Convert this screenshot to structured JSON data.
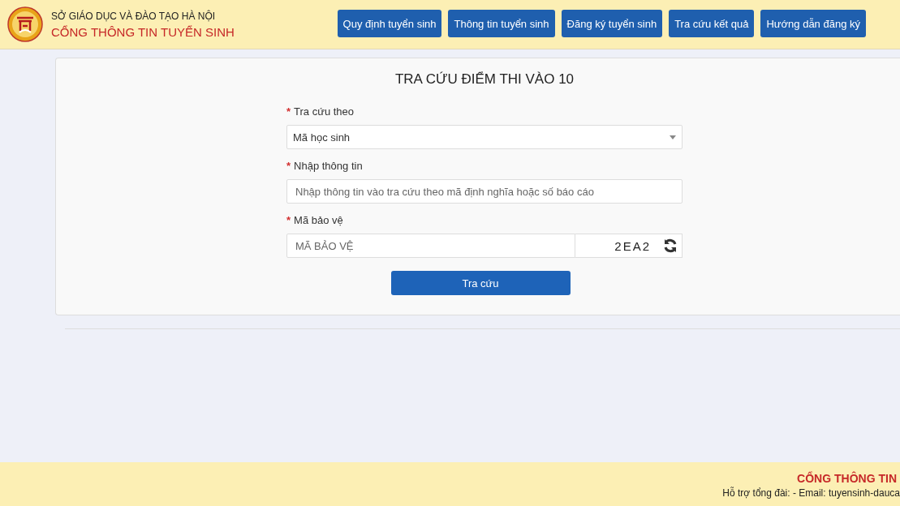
{
  "header": {
    "org": "SỞ GIÁO DỤC VÀ ĐÀO TẠO HÀ NỘI",
    "portal": "CỔNG THÔNG TIN TUYỂN SINH",
    "nav": [
      {
        "label": "Quy định tuyển sinh"
      },
      {
        "label": "Thông tin tuyển sinh"
      },
      {
        "label": "Đăng ký tuyển sinh"
      },
      {
        "label": "Tra cứu kết quả"
      },
      {
        "label": "Hướng dẫn đăng ký"
      }
    ]
  },
  "form": {
    "title": "TRA CỨU ĐIỂM THI VÀO 10",
    "fields": [
      {
        "kind": "select",
        "label": "Tra cứu theo",
        "required_mark": "*",
        "value": "Mã học sinh"
      },
      {
        "kind": "text",
        "label": "Nhập thông tin",
        "required_mark": "*",
        "placeholder": "Nhập thông tin vào tra cứu theo mã định nghĩa hoặc số báo cáo"
      },
      {
        "kind": "captcha",
        "label": "Mã bảo vệ",
        "required_mark": "*",
        "placeholder": "MÃ BẢO VỆ",
        "captcha": "2EA2"
      }
    ],
    "submit": "Tra cứu"
  },
  "footer": {
    "title": "CỔNG THÔNG TIN",
    "contact": "Hỗ trợ tổng đài: - Email: tuyensinh-dauca"
  }
}
